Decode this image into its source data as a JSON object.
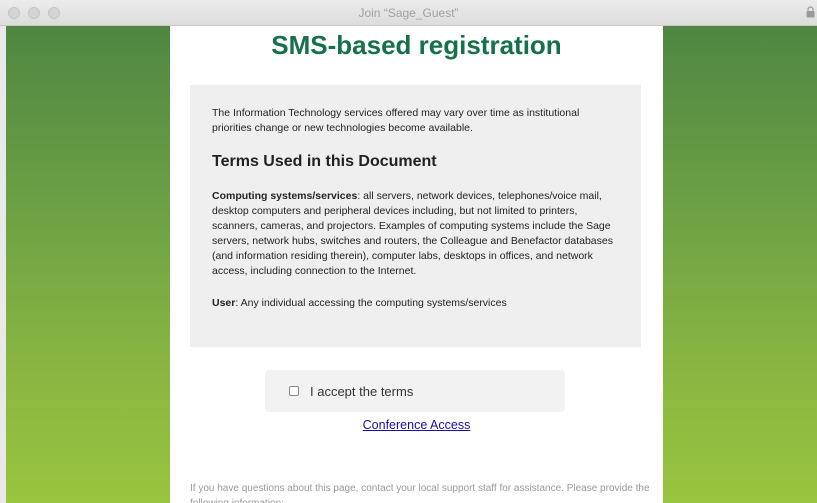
{
  "window": {
    "title": "Join “Sage_Guest”"
  },
  "page": {
    "heading": "SMS-based registration"
  },
  "terms": {
    "intro": "The Information Technology services offered may vary over time as institutional priorities change or new technologies become available.",
    "section_title": "Terms Used in this Document",
    "def1_term": "Computing systems/services",
    "def1_text": ": all servers, network devices, telephones/voice mail, desktop computers and peripheral devices including, but not limited to printers, scanners, cameras, and projectors. Examples of computing systems include the Sage servers, network hubs, switches and routers, the Colleague and Benefactor databases (and information residing therein), computer labs, desktops in offices, and network access, including connection to the Internet.",
    "def2_term": "User",
    "def2_text": ": Any individual accessing the computing systems/services"
  },
  "accept": {
    "label": "I accept the terms",
    "checked": false
  },
  "links": {
    "conference": "Conference Access"
  },
  "footer": {
    "text": "If you have questions about this page, contact your local support staff for assistance. Please provide the following information:"
  },
  "colors": {
    "heading": "#16704a",
    "link": "#1a0dab",
    "bg_top": "#4f8742",
    "bg_bottom": "#99c43f"
  }
}
